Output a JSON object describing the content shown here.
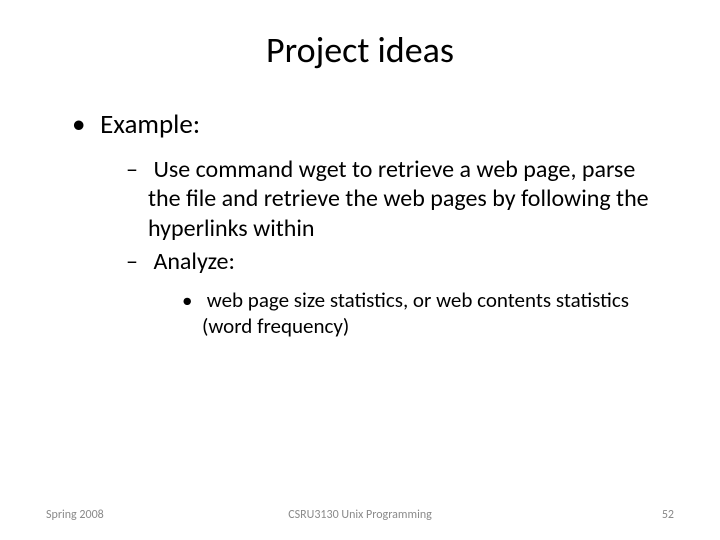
{
  "title": "Project ideas",
  "bullets": {
    "l1": "Example:",
    "l2a": "Use command wget to retrieve a web page, parse the file and retrieve the web pages by following the hyperlinks within",
    "l2b": "Analyze:",
    "l3a": "web page size statistics, or web contents statistics (word frequency)"
  },
  "footer": {
    "left": "Spring 2008",
    "center": "CSRU3130 Unix Programming",
    "right": "52"
  }
}
